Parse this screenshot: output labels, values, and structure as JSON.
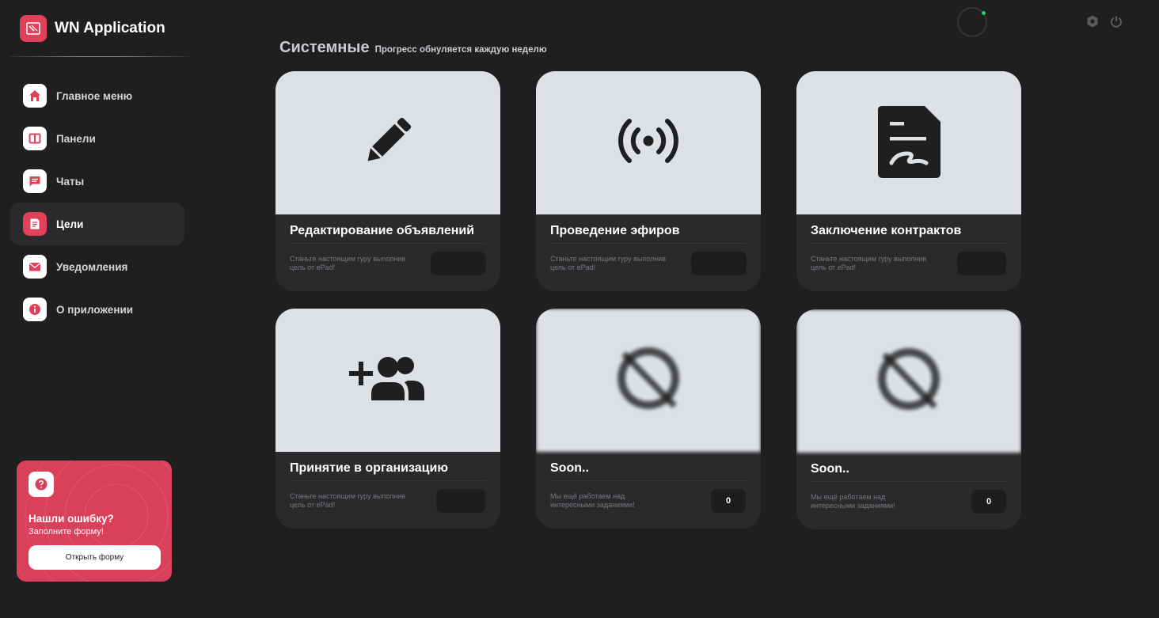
{
  "app": {
    "title": "WN Application"
  },
  "sidebar": {
    "items": [
      {
        "label": "Главное меню",
        "icon": "home-icon"
      },
      {
        "label": "Панели",
        "icon": "panel-icon"
      },
      {
        "label": "Чаты",
        "icon": "chat-icon"
      },
      {
        "label": "Цели",
        "icon": "goals-icon",
        "active": true
      },
      {
        "label": "Уведомления",
        "icon": "mail-icon"
      },
      {
        "label": "О приложении",
        "icon": "info-icon"
      }
    ]
  },
  "help": {
    "title": "Нашли ошибку?",
    "subtitle": "Заполните форму!",
    "button": "Открыть форму"
  },
  "section": {
    "title": "Системные",
    "subtitle": "Прогресс обнуляется каждую неделю"
  },
  "cards": [
    {
      "title": "Редактирование объявлений",
      "desc": "Станьте настоящим гуру выполнив цель от ePad!",
      "badge": "",
      "icon": "pencil-icon"
    },
    {
      "title": "Проведение эфиров",
      "desc": "Станьте настоящим гуру выполнив цель от ePad!",
      "badge": "",
      "icon": "broadcast-icon"
    },
    {
      "title": "Заключение контрактов",
      "desc": "Станьте настоящим гуру выполнив цель от ePad!",
      "badge": "",
      "icon": "contract-icon"
    },
    {
      "title": "Принятие в организацию",
      "desc": "Станьте настоящим гуру выполнив цель от ePad!",
      "badge": "",
      "icon": "add-users-icon"
    },
    {
      "title": "Soon..",
      "desc": "Мы ещё работаем над интересными заданиями!",
      "badge": "0",
      "icon": "unavailable-icon"
    },
    {
      "title": "Soon..",
      "desc": "Мы ещё работаем над интересными заданиями!",
      "badge": "0",
      "icon": "unavailable-icon"
    }
  ],
  "colors": {
    "accent": "#e0405a",
    "background": "#1f1f20",
    "card": "#2a2a2c",
    "card_top": "#dde1e5",
    "online": "#25d366"
  }
}
